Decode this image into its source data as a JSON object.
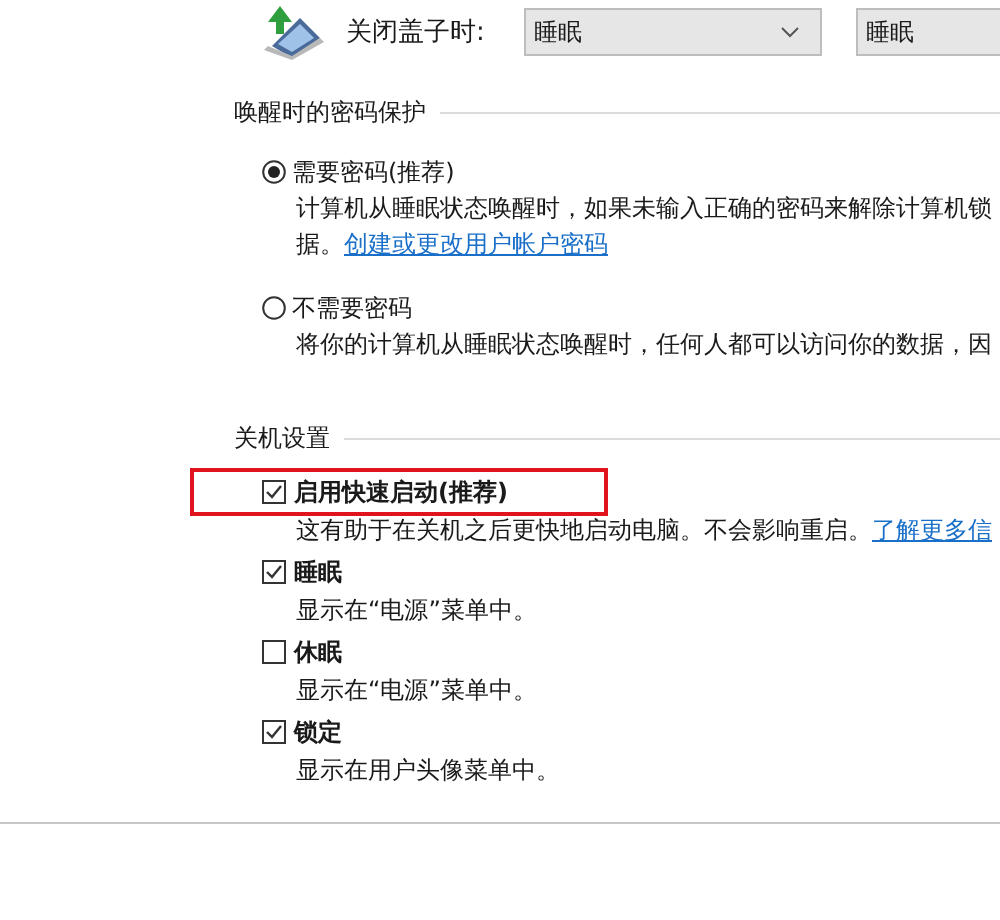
{
  "lid": {
    "label": "关闭盖子时:",
    "values": [
      "睡眠",
      "睡眠"
    ]
  },
  "password_section": {
    "title": "唤醒时的密码保护",
    "options": [
      {
        "label": "需要密码(推荐)",
        "selected": true,
        "description": "计算机从睡眠状态唤醒时，如果未输入正确的密码来解除计算机锁",
        "description_2": "据。",
        "link": "创建或更改用户帐户密码"
      },
      {
        "label": "不需要密码",
        "selected": false,
        "description": "将你的计算机从睡眠状态唤醒时，任何人都可以访问你的数据，因"
      }
    ]
  },
  "shutdown_section": {
    "title": "关机设置",
    "items": [
      {
        "label": "启用快速启动(推荐)",
        "checked": true,
        "highlighted": true,
        "description": "这有助于在关机之后更快地启动电脑。不会影响重启。",
        "link": "了解更多信"
      },
      {
        "label": "睡眠",
        "checked": true,
        "highlighted": false,
        "description": "显示在“电源”菜单中。"
      },
      {
        "label": "休眠",
        "checked": false,
        "highlighted": false,
        "description": "显示在“电源”菜单中。"
      },
      {
        "label": "锁定",
        "checked": true,
        "highlighted": false,
        "description": "显示在用户头像菜单中。"
      }
    ]
  }
}
